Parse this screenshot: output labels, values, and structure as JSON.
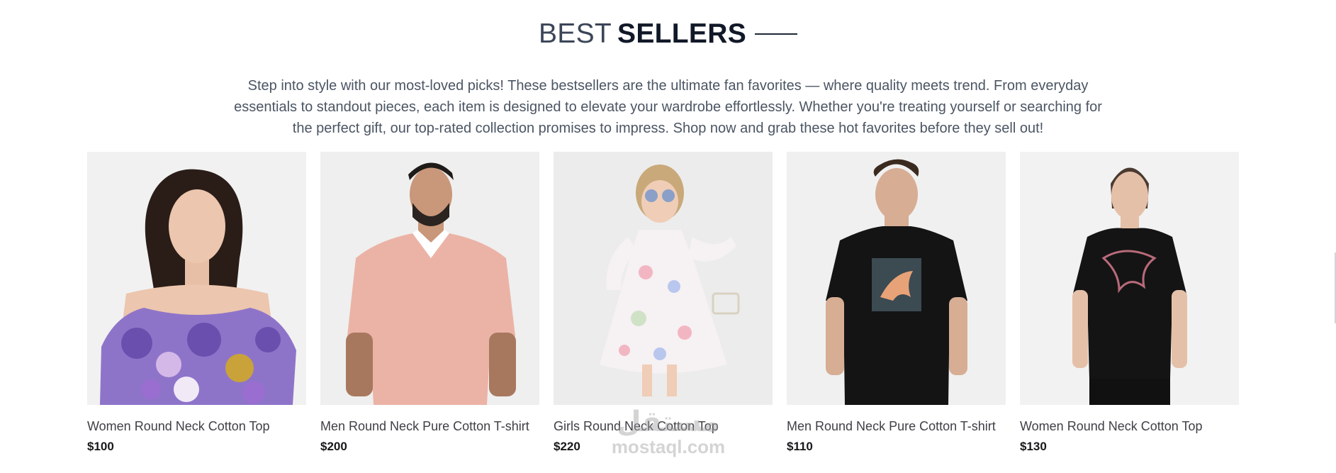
{
  "section": {
    "title_light": "BEST",
    "title_bold": "SELLERS",
    "description": "Step into style with our most-loved picks! These bestsellers are the ultimate fan favorites — where quality meets trend. From everyday essentials to standout pieces, each item is designed to elevate your wardrobe effortlessly. Whether you're treating yourself or searching for the perfect gift, our top-rated collection promises to impress. Shop now and grab these hot favorites before they sell out!"
  },
  "products": [
    {
      "name": "Women Round Neck Cotton Top",
      "price": "$100",
      "image": "woman-floral-off-shoulder-top"
    },
    {
      "name": "Men Round Neck Pure Cotton T-shirt",
      "price": "$200",
      "image": "man-pink-polo"
    },
    {
      "name": "Girls Round Neck Cotton Top",
      "price": "$220",
      "image": "girl-floral-dress"
    },
    {
      "name": "Men Round Neck Pure Cotton T-shirt",
      "price": "$110",
      "image": "man-black-puma-tee"
    },
    {
      "name": "Women Round Neck Cotton Top",
      "price": "$130",
      "image": "woman-black-puma-tee"
    }
  ],
  "watermark": {
    "arabic": "مستقل",
    "latin": "mostaql.com"
  }
}
